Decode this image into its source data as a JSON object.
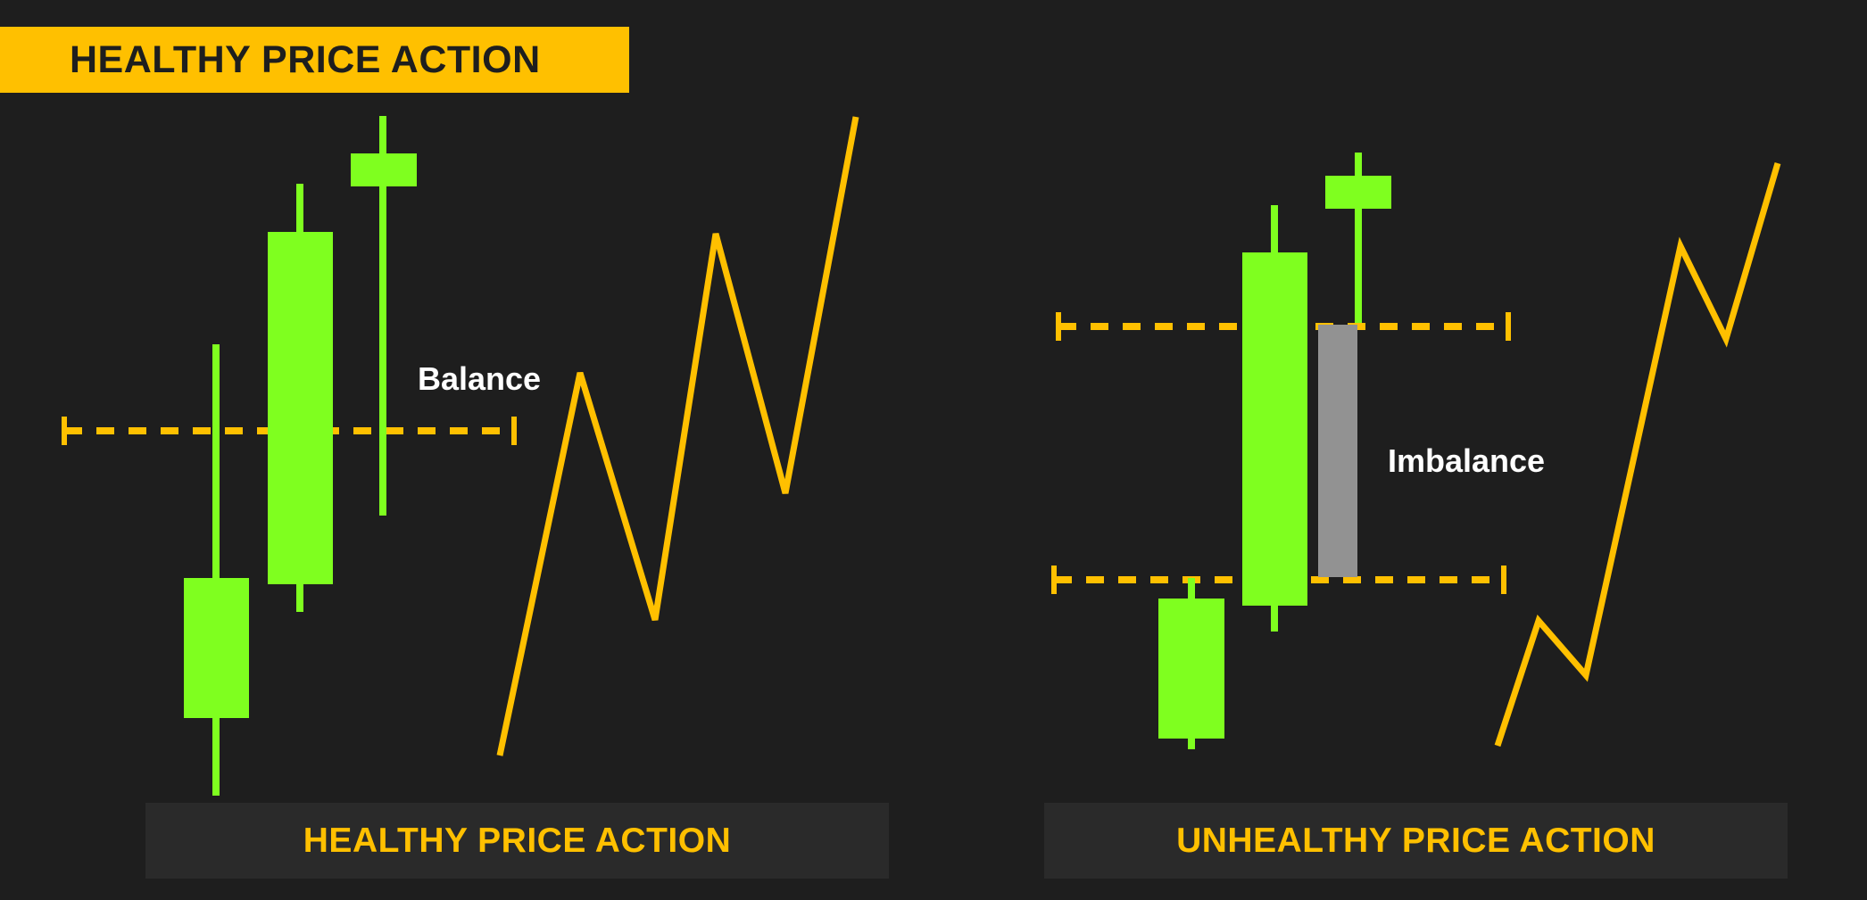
{
  "header": {
    "title": "HEALTHY PRICE ACTION"
  },
  "left_panel": {
    "caption": "HEALTHY PRICE ACTION",
    "level_label": "Balance"
  },
  "right_panel": {
    "caption": "UNHEALTHY PRICE ACTION",
    "gap_label": "Imbalance"
  },
  "colors": {
    "background": "#1e1e1e",
    "accent": "#ffc000",
    "bullish_candle": "#7fff1f",
    "imbalance_fill": "#929292",
    "caption_bg": "#2a2a2a",
    "label_text": "#ffffff"
  }
}
